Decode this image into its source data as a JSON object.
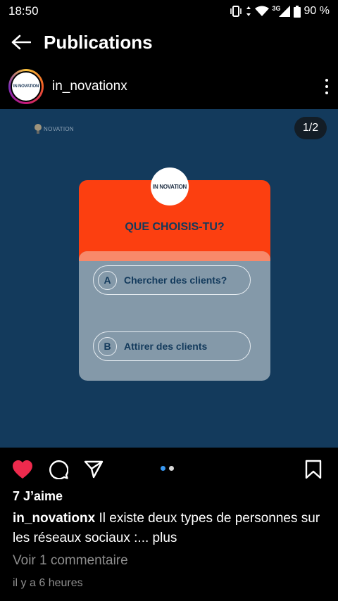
{
  "status_bar": {
    "time": "18:50",
    "network": "3G",
    "battery": "90 %"
  },
  "app_bar": {
    "title": "Publications"
  },
  "post": {
    "username": "in_novationx",
    "avatar_text": "IN NOVATION",
    "page_counter": "1/2",
    "corner_logo_text": "NOVATION",
    "quiz": {
      "logo_text": "IN NOVATION",
      "question": "QUE CHOISIS-TU?",
      "options": [
        {
          "letter": "A",
          "text": "Chercher des clients?"
        },
        {
          "letter": "B",
          "text": "Attirer des clients"
        }
      ]
    },
    "carousel": {
      "current": 1,
      "total": 2
    },
    "likes": "7 J’aime",
    "caption": {
      "user": "in_novationx",
      "text": "Il existe deux types de personnes sur les réseaux sociaux :...",
      "more": "plus"
    },
    "view_comments": "Voir 1 commentaire",
    "timestamp": "il y a 6 heures"
  },
  "colors": {
    "like_active": "#ee2a4d",
    "image_bg": "#133a5c",
    "quiz_orange": "#fc3f10",
    "quiz_gray": "#8499a9",
    "dot_active": "#3897f0"
  },
  "icons": [
    "vibrate-icon",
    "data-arrows-icon",
    "wifi-icon",
    "signal-icon",
    "battery-icon",
    "back-arrow-icon",
    "more-vertical-icon",
    "heart-icon",
    "comment-icon",
    "share-icon",
    "bookmark-icon",
    "lightbulb-icon"
  ]
}
